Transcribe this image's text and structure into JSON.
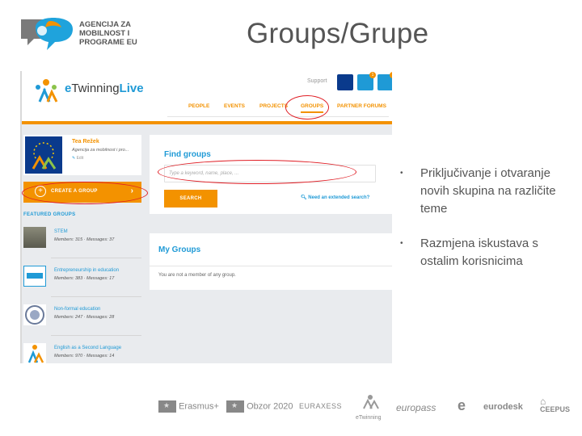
{
  "slide": {
    "title": "Groups/Grupe",
    "agency_logo_text": "AGENCIJA ZA\nMOBILNOST I\nPROGRAME EU"
  },
  "etwinning": {
    "logo_prefix": "e",
    "logo_main": "Twinning",
    "logo_suffix": "Live",
    "support": "Support",
    "badges": [
      "1",
      "1"
    ],
    "nav": [
      "PEOPLE",
      "EVENTS",
      "PROJECTS",
      "GROUPS",
      "PARTNER FORUMS"
    ],
    "active_nav": "GROUPS",
    "profile": {
      "name": "Tea Režek",
      "org": "Agencija za mobilnost i pro...",
      "edit": "Edit"
    },
    "create_group_label": "CREATE A GROUP",
    "featured_title": "FEATURED GROUPS",
    "featured_groups": [
      {
        "name": "STEM",
        "meta": "Members: 315  ·  Messages: 37"
      },
      {
        "name": "Entrepreneurship in education",
        "meta": "Members: 383  ·  Messages: 17"
      },
      {
        "name": "Non-formal education",
        "meta": "Members: 247  ·  Messages: 28"
      },
      {
        "name": "English as a Second Language",
        "meta": "Members: 970  ·  Messages: 14"
      }
    ],
    "find_groups": {
      "title": "Find groups",
      "placeholder": "Type a keyword, name, place, ...",
      "search_button": "SEARCH",
      "extended_link": "Need an extended search?"
    },
    "my_groups": {
      "title": "My Groups",
      "empty_text": "You are not a member of any group."
    },
    "colors": {
      "accent": "#f39200",
      "link": "#1f9ad6",
      "highlight": "#e01e25"
    }
  },
  "bullets": [
    "Priključivanje i otvaranje novih skupina na različite teme",
    "Razmjena iskustava s ostalim korisnicima"
  ],
  "footer_logos": [
    "Erasmus+",
    "Obzor 2020",
    "EURAXESS",
    "eTwinning",
    "europass",
    "eurodesk",
    "CEEPUS"
  ]
}
